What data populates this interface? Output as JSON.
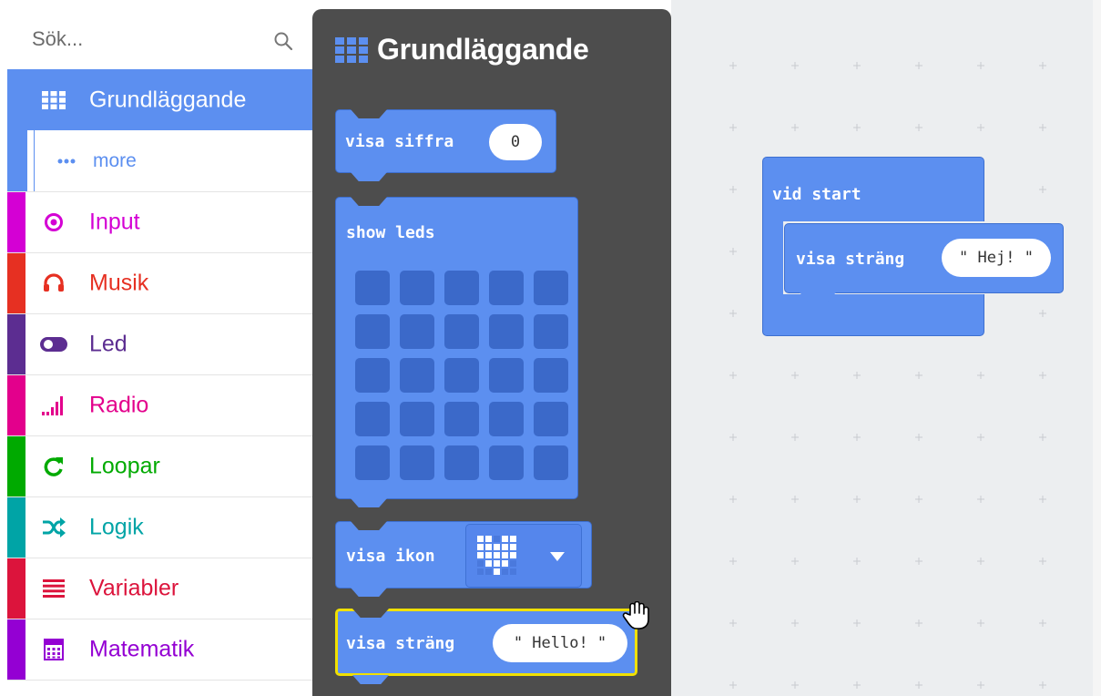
{
  "search": {
    "placeholder": "Sök..."
  },
  "toolbox": {
    "categories": [
      {
        "id": "basic",
        "label": "Grundläggande",
        "icon": "grid-icon",
        "color": "#5c8ff0"
      },
      {
        "id": "more",
        "label": "more",
        "icon": "more-icon",
        "color": "#5c8ff0"
      },
      {
        "id": "input",
        "label": "Input",
        "icon": "target-icon",
        "color": "#d400d4"
      },
      {
        "id": "music",
        "label": "Musik",
        "icon": "headphones-icon",
        "color": "#e63022"
      },
      {
        "id": "led",
        "label": "Led",
        "icon": "toggle-icon",
        "color": "#5c2d91"
      },
      {
        "id": "radio",
        "label": "Radio",
        "icon": "signal-icon",
        "color": "#e3008c"
      },
      {
        "id": "loops",
        "label": "Loopar",
        "icon": "refresh-icon",
        "color": "#00aa00"
      },
      {
        "id": "logic",
        "label": "Logik",
        "icon": "shuffle-icon",
        "color": "#00a4a6"
      },
      {
        "id": "variables",
        "label": "Variabler",
        "icon": "lines-icon",
        "color": "#dc143c"
      },
      {
        "id": "math",
        "label": "Matematik",
        "icon": "calculator-icon",
        "color": "#9400d3"
      }
    ]
  },
  "flyout": {
    "title": "Grundläggande",
    "blocks": {
      "show_number": {
        "label": "visa siffra",
        "value": "0"
      },
      "show_leds": {
        "label": "show leds"
      },
      "show_icon": {
        "label": "visa ikon"
      },
      "show_string": {
        "label": "visa sträng",
        "value": "\" Hello! \""
      }
    }
  },
  "workspace": {
    "on_start": {
      "label": "vid start"
    },
    "show_string": {
      "label": "visa sträng",
      "value": "\" Hej! \""
    }
  },
  "colors": {
    "block": "#5c8ff0",
    "flyout_bg": "#4d4d4d",
    "workspace_bg": "#eceef0",
    "selection": "#f0e000"
  }
}
